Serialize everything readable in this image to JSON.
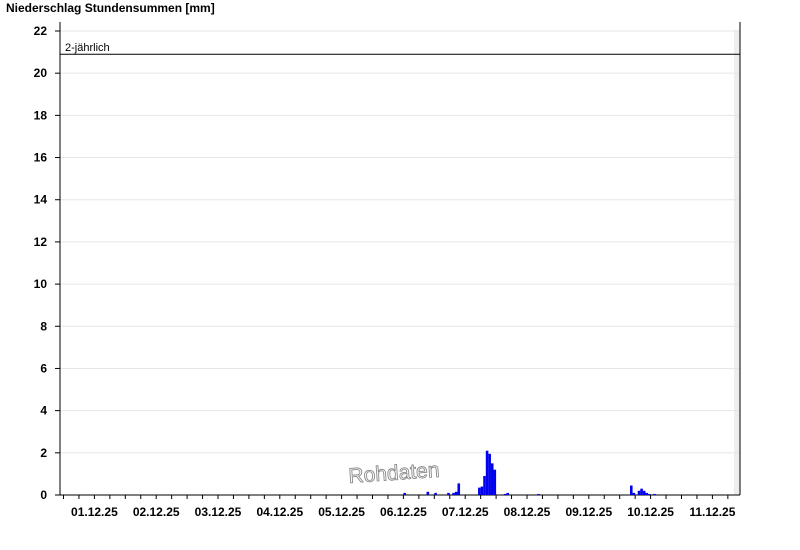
{
  "chart_data": {
    "type": "bar",
    "title": "Niederschlag Stundensummen [mm]",
    "xlabel": "",
    "ylabel": "",
    "ylim": [
      0,
      22
    ],
    "yticks": [
      "0",
      "2",
      "4",
      "6",
      "8",
      "10",
      "12",
      "14",
      "16",
      "18",
      "20",
      "22"
    ],
    "x_tick_labels": [
      "01.12.25",
      "02.12.25",
      "03.12.25",
      "04.12.25",
      "05.12.25",
      "06.12.25",
      "07.12.25",
      "08.12.25",
      "09.12.25",
      "10.12.25",
      "11.12.25"
    ],
    "grid": true,
    "bar_color": "#0000ee",
    "reference_line": {
      "label": "2-jährlich",
      "value": 20.9
    },
    "watermark": "Rohdaten",
    "series": [
      {
        "values": [
          {
            "x": "06.12.25 12:00",
            "y": 0.1
          },
          {
            "x": "06.12.25 21:00",
            "y": 0.15
          },
          {
            "x": "07.12.25 00:00",
            "y": 0.1
          },
          {
            "x": "07.12.25 05:00",
            "y": 0.1
          },
          {
            "x": "07.12.25 07:00",
            "y": 0.1
          },
          {
            "x": "07.12.25 08:00",
            "y": 0.15
          },
          {
            "x": "07.12.25 09:00",
            "y": 0.55
          },
          {
            "x": "07.12.25 17:00",
            "y": 0.35
          },
          {
            "x": "07.12.25 18:00",
            "y": 0.4
          },
          {
            "x": "07.12.25 19:00",
            "y": 0.9
          },
          {
            "x": "07.12.25 20:00",
            "y": 2.1
          },
          {
            "x": "07.12.25 21:00",
            "y": 1.95
          },
          {
            "x": "07.12.25 22:00",
            "y": 1.5
          },
          {
            "x": "07.12.25 23:00",
            "y": 1.2
          },
          {
            "x": "08.12.25 03:00",
            "y": 0.05
          },
          {
            "x": "08.12.25 04:00",
            "y": 0.1
          },
          {
            "x": "08.12.25 16:00",
            "y": 0.05
          },
          {
            "x": "10.12.25 04:00",
            "y": 0.45
          },
          {
            "x": "10.12.25 05:00",
            "y": 0.1
          },
          {
            "x": "10.12.25 07:00",
            "y": 0.2
          },
          {
            "x": "10.12.25 08:00",
            "y": 0.3
          },
          {
            "x": "10.12.25 09:00",
            "y": 0.2
          },
          {
            "x": "10.12.25 10:00",
            "y": 0.1
          },
          {
            "x": "10.12.25 11:00",
            "y": 0.05
          },
          {
            "x": "10.12.25 13:00",
            "y": 0.05
          }
        ]
      }
    ]
  }
}
